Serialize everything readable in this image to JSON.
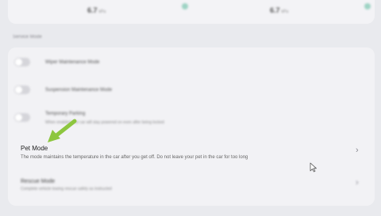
{
  "tire_pressure": {
    "left": {
      "value": "6.7",
      "unit": "kPa"
    },
    "right": {
      "value": "6.7",
      "unit": "kPa"
    }
  },
  "section_title": "Service Mode",
  "rows": [
    {
      "label": "Wiper Maintenance Mode"
    },
    {
      "label": "Suspension Maintenance Mode"
    },
    {
      "label": "Temporary Parking",
      "description": "When enabled, the car will stay powered on even after being locked"
    }
  ],
  "pet_mode": {
    "title": "Pet Mode",
    "description": "The mode maintains the temperature in the car after you get off. Do not leave your pet in the car for too long"
  },
  "rescue_mode": {
    "title": "Rescue Mode",
    "description": "Complete vehicle towing rescue safely as instructed"
  },
  "colors": {
    "background": "#e9eaee",
    "panel": "#f2f2f5",
    "highlight_arrow": "#8dc63f",
    "tire_dot": "#9ed3c4"
  },
  "icons": {
    "chevron": "chevron-right-icon",
    "cursor": "mouse-pointer-icon",
    "arrow": "highlight-arrow-icon"
  }
}
